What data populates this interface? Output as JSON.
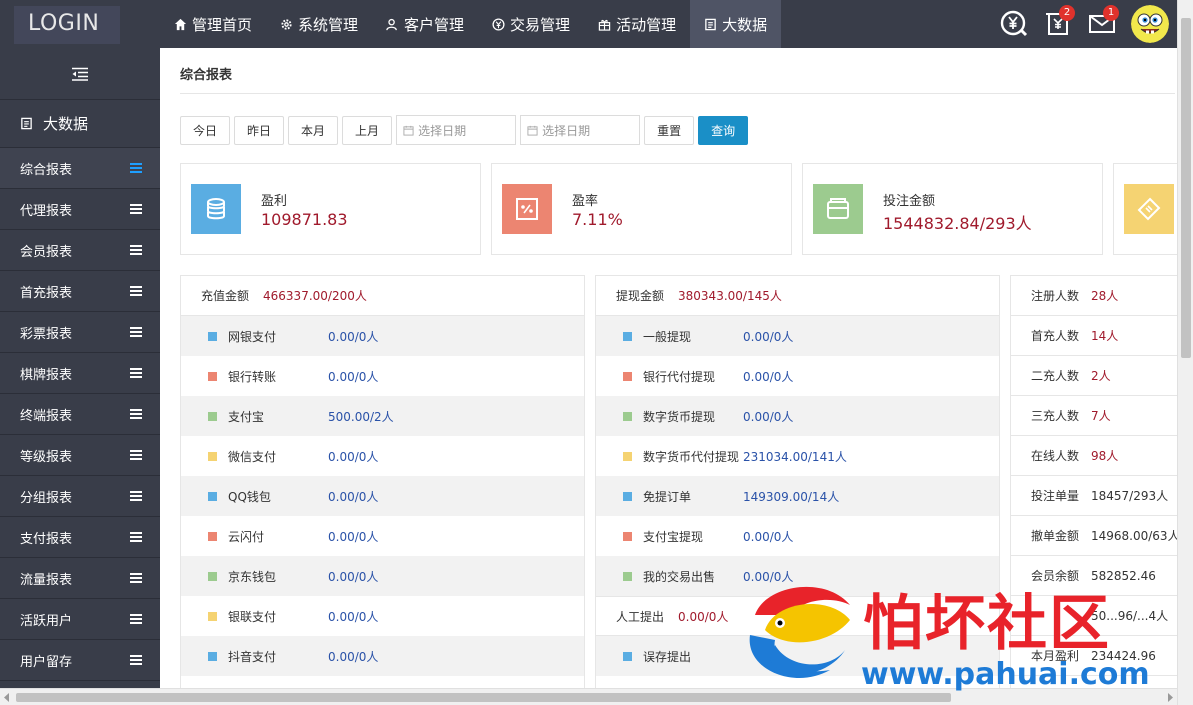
{
  "app": {
    "logo": "LOGIN"
  },
  "nav": [
    {
      "label": "管理首页",
      "icon": "home-icon"
    },
    {
      "label": "系统管理",
      "icon": "gear-icon"
    },
    {
      "label": "客户管理",
      "icon": "user-icon"
    },
    {
      "label": "交易管理",
      "icon": "coin-icon"
    },
    {
      "label": "活动管理",
      "icon": "gift-icon"
    },
    {
      "label": "大数据",
      "icon": "document-icon",
      "active": true
    }
  ],
  "toolbar": {
    "currency_icon": "yen-circle-icon",
    "receipt_badge": "2",
    "mail_badge": "1"
  },
  "sidebar": {
    "section_title": "大数据",
    "items": [
      {
        "label": "综合报表",
        "active": true
      },
      {
        "label": "代理报表"
      },
      {
        "label": "会员报表"
      },
      {
        "label": "首充报表"
      },
      {
        "label": "彩票报表"
      },
      {
        "label": "棋牌报表"
      },
      {
        "label": "终端报表"
      },
      {
        "label": "等级报表"
      },
      {
        "label": "分组报表"
      },
      {
        "label": "支付报表"
      },
      {
        "label": "流量报表"
      },
      {
        "label": "活跃用户"
      },
      {
        "label": "用户留存"
      }
    ]
  },
  "main": {
    "title": "综合报表",
    "filters": {
      "today": "今日",
      "yesterday": "昨日",
      "this_month": "本月",
      "last_month": "上月",
      "start_placeholder": "选择日期",
      "end_placeholder": "选择日期",
      "reset": "重置",
      "query": "查询"
    },
    "cards": [
      {
        "label": "盈利",
        "value": "109871.83",
        "color": "#5aade2"
      },
      {
        "label": "盈率",
        "value": "7.11%",
        "color": "#ec8571"
      },
      {
        "label": "投注金额",
        "value": "1544832.84/293人",
        "color": "#9ccb8f"
      },
      {
        "label": "",
        "value": "",
        "color": "#f5d372"
      }
    ],
    "recharge": {
      "label": "充值金额",
      "value": "466337.00/200人",
      "rows": [
        {
          "label": "网银支付",
          "value": "0.00/0人",
          "color": "#5aade2"
        },
        {
          "label": "银行转账",
          "value": "0.00/0人",
          "color": "#ec8571"
        },
        {
          "label": "支付宝",
          "value": "500.00/2人",
          "color": "#9ccb8f"
        },
        {
          "label": "微信支付",
          "value": "0.00/0人",
          "color": "#f5d372"
        },
        {
          "label": "QQ钱包",
          "value": "0.00/0人",
          "color": "#5aade2"
        },
        {
          "label": "云闪付",
          "value": "0.00/0人",
          "color": "#ec8571"
        },
        {
          "label": "京东钱包",
          "value": "0.00/0人",
          "color": "#9ccb8f"
        },
        {
          "label": "银联支付",
          "value": "0.00/0人",
          "color": "#f5d372"
        },
        {
          "label": "抖音支付",
          "value": "0.00/0人",
          "color": "#5aade2"
        }
      ]
    },
    "withdraw": {
      "label": "提现金额",
      "value": "380343.00/145人",
      "rows": [
        {
          "label": "一般提现",
          "value": "0.00/0人",
          "color": "#5aade2"
        },
        {
          "label": "银行代付提现",
          "value": "0.00/0人",
          "color": "#ec8571"
        },
        {
          "label": "数字货币提现",
          "value": "0.00/0人",
          "color": "#9ccb8f"
        },
        {
          "label": "数字货币代付提现",
          "value": "231034.00/141人",
          "color": "#f5d372"
        },
        {
          "label": "免提订单",
          "value": "149309.00/14人",
          "color": "#5aade2"
        },
        {
          "label": "支付宝提现",
          "value": "0.00/0人",
          "color": "#ec8571"
        },
        {
          "label": "我的交易出售",
          "value": "0.00/0人",
          "color": "#9ccb8f"
        }
      ],
      "manual": {
        "label": "人工提出",
        "value": "0.00/0人"
      },
      "manual_rows": [
        {
          "label": "误存提出",
          "value": "",
          "color": "#5aade2"
        }
      ]
    },
    "stats": [
      {
        "label": "注册人数",
        "value": "28人"
      },
      {
        "label": "首充人数",
        "value": "14人"
      },
      {
        "label": "二充人数",
        "value": "2人"
      },
      {
        "label": "三充人数",
        "value": "7人"
      },
      {
        "label": "在线人数",
        "value": "98人"
      },
      {
        "label": "投注单量",
        "value": "18457/293人",
        "dark": true
      },
      {
        "label": "撤单金额",
        "value": "14968.00/63人",
        "dark": true
      },
      {
        "label": "会员余额",
        "value": "582852.46",
        "dark": true
      },
      {
        "label": "",
        "value": "50...96/...4人",
        "dark": true
      },
      {
        "label": "本月盈利",
        "value": "234424.96",
        "dark": true
      }
    ]
  },
  "watermark": {
    "title": "怕坏社区",
    "url": "www.pahuai.com"
  }
}
